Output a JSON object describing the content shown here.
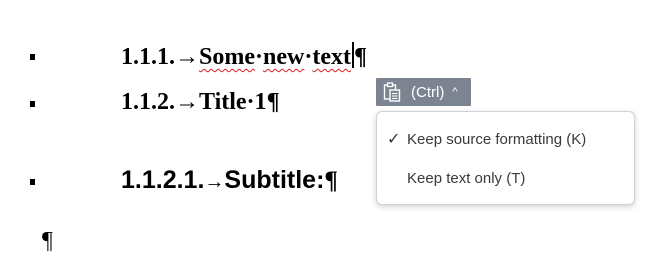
{
  "document": {
    "lines": [
      {
        "number": "1.1.1.",
        "arrow": "→",
        "words": [
          "Some",
          "new",
          "text"
        ],
        "dot": "·",
        "pilcrow": "¶"
      },
      {
        "number": "1.1.2.",
        "arrow": "→",
        "text": "Title·1",
        "pilcrow": "¶"
      },
      {
        "number": "1.1.2.1.",
        "arrow": "→",
        "text": "Subtitle:",
        "pilcrow": "¶"
      }
    ],
    "empty_paragraph_mark": "¶"
  },
  "paste_button": {
    "label": "(Ctrl)",
    "caret": "^",
    "icon": "clipboard-icon"
  },
  "paste_menu": {
    "items": [
      {
        "label": "Keep source formatting (K)",
        "checked": true,
        "check": "✓"
      },
      {
        "label": "Keep text only (T)",
        "checked": false
      }
    ]
  },
  "colors": {
    "paste_button_bg": "#7b8490",
    "spellcheck_underline": "#e02020"
  }
}
